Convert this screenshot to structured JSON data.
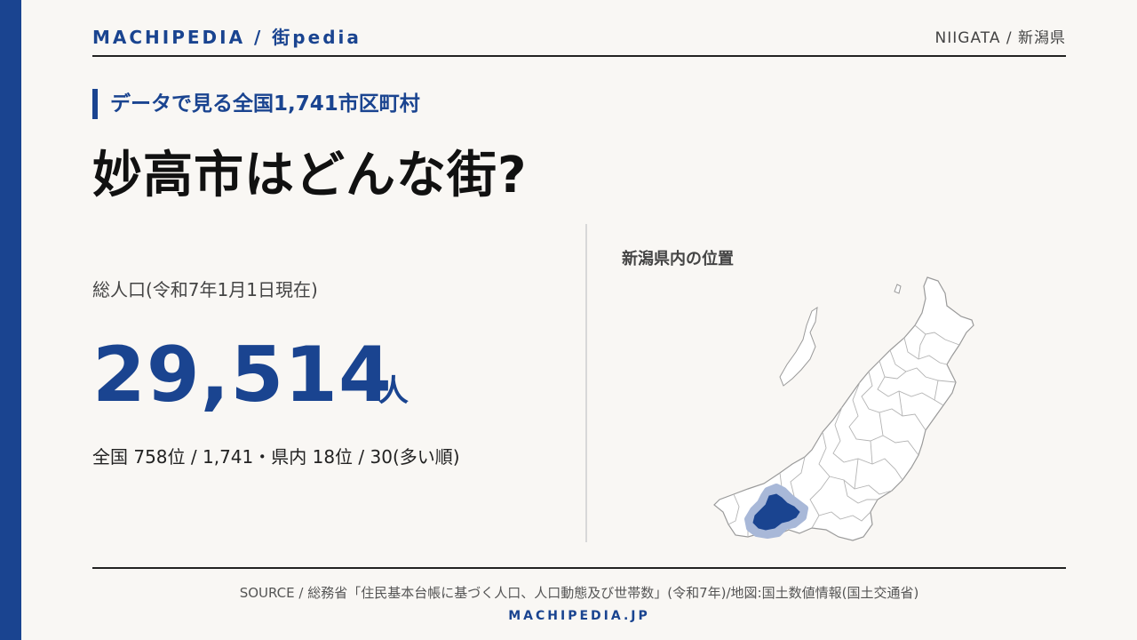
{
  "header": {
    "brand": "MACHIPEDIA / 街pedia",
    "prefecture": "NIIGATA / 新潟県"
  },
  "kicker": "データで見る全国1,741市区町村",
  "title": "妙高市はどんな街?",
  "population": {
    "label": "総人口(令和7年1月1日現在)",
    "value": "29,514",
    "unit": "人",
    "rank": "全国 758位 / 1,741・県内 18位 / 30(多い順)"
  },
  "map": {
    "title": "新潟県内の位置",
    "highlight_color": "#1a4490",
    "halo_color": "#a8b8d8",
    "outline_color": "#9a9a9a"
  },
  "footer": {
    "source": "SOURCE / 総務省「住民基本台帳に基づく人口、人口動態及び世帯数」(令和7年)/地図:国土数値情報(国土交通省)",
    "brand": "MACHIPEDIA.JP"
  },
  "colors": {
    "accent": "#1a4490",
    "background": "#f9f7f4"
  }
}
